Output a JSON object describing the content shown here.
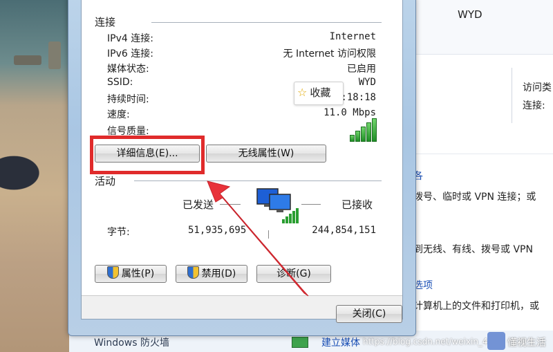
{
  "dialog": {
    "connection_section_title": "连接",
    "rows": [
      {
        "label": "IPv4 连接:",
        "value": "Internet"
      },
      {
        "label": "IPv6 连接:",
        "value": "无 Internet 访问权限"
      },
      {
        "label": "媒体状态:",
        "value": "已启用"
      },
      {
        "label": "SSID:",
        "value": "WYD"
      },
      {
        "label": "持续时间:",
        "value": "3:18:18"
      },
      {
        "label": "速度:",
        "value": "11.0 Mbps"
      }
    ],
    "signal_quality_label": "信号质量:",
    "signal_bars": 5,
    "details_button": "详细信息(E)...",
    "wireless_props_button": "无线属性(W)",
    "activity_section_title": "活动",
    "sent_label": "已发送",
    "received_label": "已接收",
    "bytes_label": "字节:",
    "bytes_sent": "51,935,695",
    "bytes_received": "244,854,151",
    "properties_button": "属性(P)",
    "disable_button": "禁用(D)",
    "diagnose_button": "诊断(G)",
    "close_button": "关闭(C)"
  },
  "tooltip": {
    "icon": "star-icon",
    "label": "收藏"
  },
  "right_panel": {
    "network_name": "WYD",
    "access_type_label": "访问类",
    "connection_label": "连接:",
    "link1": "各",
    "text1": "拨号、临时或 VPN 连接；或",
    "text2": "到无线、有线、拨号或 VPN",
    "link2": "选项",
    "text3": "计算机上的文件和打印机，或"
  },
  "bottom_bar": {
    "firewall_label": "Windows 防火墙",
    "link": "建立媒体",
    "watermark": "https://blog.csdn.net/weixin_4",
    "watermark_logo": "懂视生活"
  },
  "colors": {
    "highlight": "#e02b2b",
    "link": "#1a4fb5",
    "signal": "#2a9e31"
  }
}
